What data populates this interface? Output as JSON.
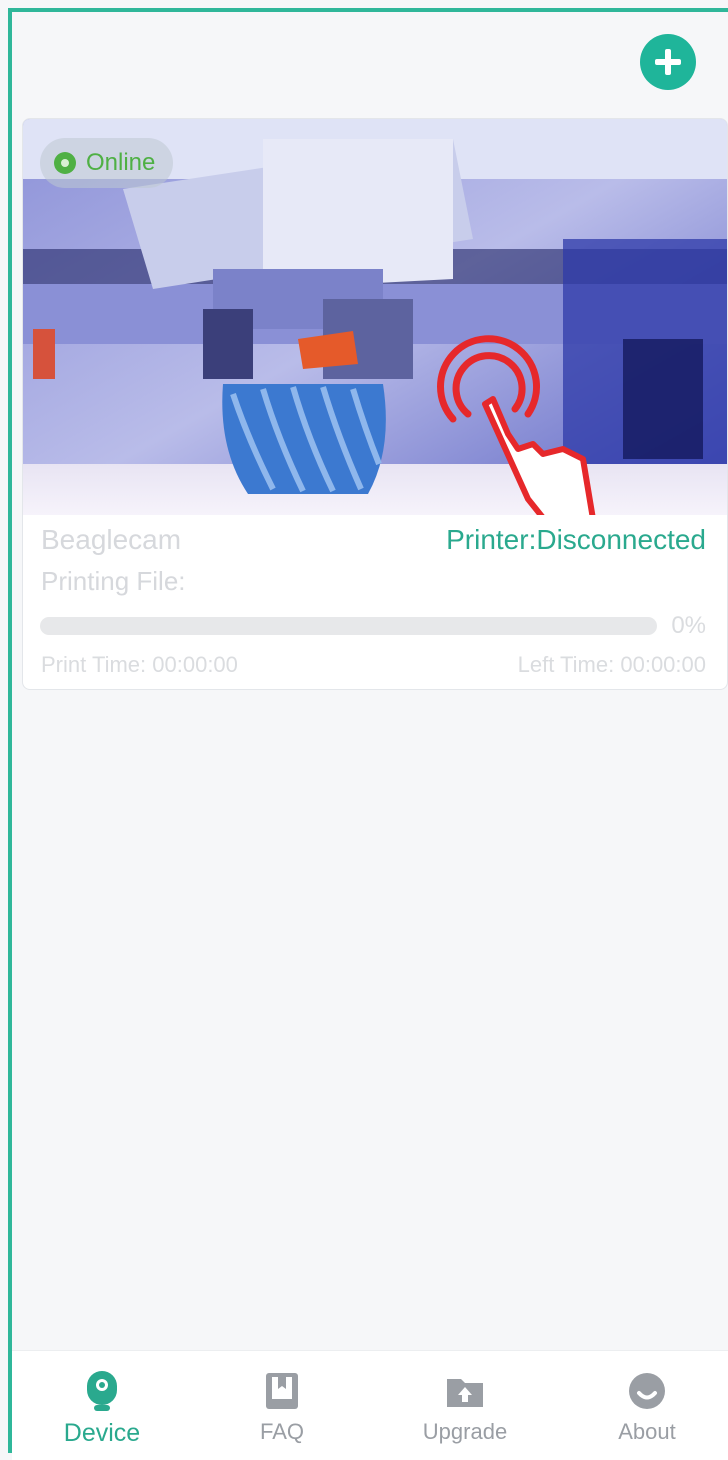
{
  "device_card": {
    "status_badge": "Online",
    "camera_name": "Beaglecam",
    "printer_status": "Printer:Disconnected",
    "printing_file_label": "Printing File:",
    "progress_percent": 0,
    "progress_text": "0%",
    "print_time_label": "Print Time:",
    "print_time_value": "00:00:00",
    "left_time_label": "Left Time:",
    "left_time_value": "00:00:00"
  },
  "tabs": [
    {
      "label": "Device",
      "icon": "camera-icon"
    },
    {
      "label": "FAQ",
      "icon": "book-icon"
    },
    {
      "label": "Upgrade",
      "icon": "folder-upload-icon"
    },
    {
      "label": "About",
      "icon": "smiley-icon"
    }
  ],
  "colors": {
    "accent": "#2fb79a",
    "online": "#4fb044",
    "tab_inactive": "#9a9ea4"
  }
}
